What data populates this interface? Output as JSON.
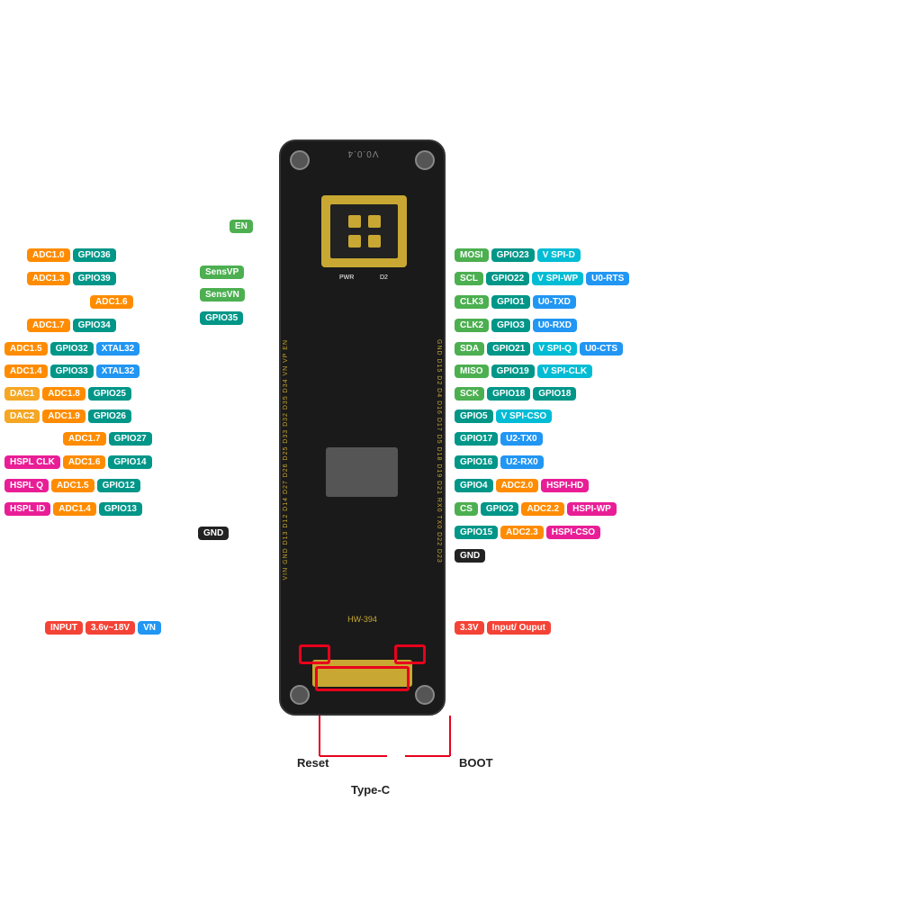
{
  "board": {
    "version": "V0.0.4",
    "hwLabel": "HW-394",
    "pwr": "PWR",
    "d2": "D2"
  },
  "labels": {
    "reset": "Reset",
    "typec": "Type-C",
    "boot": "BOOT"
  },
  "leftPins": [
    {
      "row": 0,
      "badges": [
        {
          "text": "EN",
          "color": "badge-green"
        }
      ]
    },
    {
      "row": 1,
      "badges": [
        {
          "text": "ADC1.0",
          "color": "badge-orange"
        },
        {
          "text": "GPIO36",
          "color": "badge-teal"
        }
      ]
    },
    {
      "row": 2,
      "badges": [
        {
          "text": "ADC1.3",
          "color": "badge-orange"
        },
        {
          "text": "GPIO39",
          "color": "badge-teal"
        }
      ]
    },
    {
      "row": 3,
      "badges": [
        {
          "text": "ADC1.6",
          "color": "badge-orange"
        }
      ]
    },
    {
      "row": 4,
      "badges": [
        {
          "text": "ADC1.7",
          "color": "badge-orange"
        },
        {
          "text": "GPIO34",
          "color": "badge-teal"
        }
      ]
    },
    {
      "row": 5,
      "badges": [
        {
          "text": "ADC1.5",
          "color": "badge-orange"
        },
        {
          "text": "GPIO32",
          "color": "badge-teal"
        },
        {
          "text": "XTAL32",
          "color": "badge-blue"
        }
      ]
    },
    {
      "row": 6,
      "badges": [
        {
          "text": "ADC1.4",
          "color": "badge-orange"
        },
        {
          "text": "GPIO33",
          "color": "badge-teal"
        },
        {
          "text": "XTAL32",
          "color": "badge-blue"
        }
      ]
    },
    {
      "row": 7,
      "badges": [
        {
          "text": "DAC1",
          "color": "badge-yellow"
        },
        {
          "text": "ADC1.8",
          "color": "badge-orange"
        },
        {
          "text": "GPIO25",
          "color": "badge-teal"
        }
      ]
    },
    {
      "row": 8,
      "badges": [
        {
          "text": "DAC2",
          "color": "badge-yellow"
        },
        {
          "text": "ADC1.9",
          "color": "badge-orange"
        },
        {
          "text": "GPIO26",
          "color": "badge-teal"
        }
      ]
    },
    {
      "row": 9,
      "badges": [
        {
          "text": "ADC1.7",
          "color": "badge-orange"
        },
        {
          "text": "GPIO27",
          "color": "badge-teal"
        }
      ]
    },
    {
      "row": 10,
      "badges": [
        {
          "text": "HSPL CLK",
          "color": "badge-pink"
        },
        {
          "text": "ADC1.6",
          "color": "badge-orange"
        },
        {
          "text": "GPIO14",
          "color": "badge-teal"
        }
      ]
    },
    {
      "row": 11,
      "badges": [
        {
          "text": "HSPL Q",
          "color": "badge-pink"
        },
        {
          "text": "ADC1.5",
          "color": "badge-orange"
        },
        {
          "text": "GPIO12",
          "color": "badge-teal"
        }
      ]
    },
    {
      "row": 12,
      "badges": [
        {
          "text": "HSPL ID",
          "color": "badge-pink"
        },
        {
          "text": "ADC1.4",
          "color": "badge-orange"
        },
        {
          "text": "GPIO13",
          "color": "badge-teal"
        }
      ]
    },
    {
      "row": 13,
      "badges": [
        {
          "text": "GND",
          "color": "badge-black"
        }
      ]
    },
    {
      "row": 14,
      "badges": [
        {
          "text": "INPUT",
          "color": "badge-red"
        },
        {
          "text": "3.6v~18V",
          "color": "badge-red"
        },
        {
          "text": "VN",
          "color": "badge-blue"
        }
      ]
    }
  ],
  "rightPins": [
    {
      "row": 0,
      "badges": [
        {
          "text": "MOSI",
          "color": "badge-green"
        },
        {
          "text": "GPIO23",
          "color": "badge-teal"
        },
        {
          "text": "V SPI-D",
          "color": "badge-cyan"
        }
      ]
    },
    {
      "row": 1,
      "badges": [
        {
          "text": "SCL",
          "color": "badge-green"
        },
        {
          "text": "GPIO22",
          "color": "badge-teal"
        },
        {
          "text": "V SPI-WP",
          "color": "badge-cyan"
        },
        {
          "text": "U0-RTS",
          "color": "badge-blue"
        }
      ]
    },
    {
      "row": 2,
      "badges": [
        {
          "text": "CLK3",
          "color": "badge-green"
        },
        {
          "text": "GPIO1",
          "color": "badge-teal"
        },
        {
          "text": "U0-TXD",
          "color": "badge-blue"
        }
      ]
    },
    {
      "row": 3,
      "badges": [
        {
          "text": "CLK2",
          "color": "badge-green"
        },
        {
          "text": "GPIO3",
          "color": "badge-teal"
        },
        {
          "text": "U0-RXD",
          "color": "badge-blue"
        }
      ]
    },
    {
      "row": 4,
      "badges": [
        {
          "text": "SDA",
          "color": "badge-green"
        },
        {
          "text": "GPIO21",
          "color": "badge-teal"
        },
        {
          "text": "V SPI-Q",
          "color": "badge-cyan"
        },
        {
          "text": "U0-CTS",
          "color": "badge-blue"
        }
      ]
    },
    {
      "row": 5,
      "badges": [
        {
          "text": "MISO",
          "color": "badge-green"
        },
        {
          "text": "GPIO19",
          "color": "badge-teal"
        },
        {
          "text": "V SPI-CLK",
          "color": "badge-cyan"
        }
      ]
    },
    {
      "row": 6,
      "badges": [
        {
          "text": "SCK",
          "color": "badge-green"
        },
        {
          "text": "GPIO18",
          "color": "badge-teal"
        },
        {
          "text": "GPIO18",
          "color": "badge-teal"
        }
      ]
    },
    {
      "row": 7,
      "badges": [
        {
          "text": "GPIO5",
          "color": "badge-teal"
        },
        {
          "text": "V SPI-CSO",
          "color": "badge-cyan"
        }
      ]
    },
    {
      "row": 8,
      "badges": [
        {
          "text": "GPIO17",
          "color": "badge-teal"
        },
        {
          "text": "U2-TX0",
          "color": "badge-blue"
        }
      ]
    },
    {
      "row": 9,
      "badges": [
        {
          "text": "GPIO16",
          "color": "badge-teal"
        },
        {
          "text": "U2-RX0",
          "color": "badge-blue"
        }
      ]
    },
    {
      "row": 10,
      "badges": [
        {
          "text": "GPIO4",
          "color": "badge-teal"
        },
        {
          "text": "ADC2.0",
          "color": "badge-orange"
        },
        {
          "text": "HSPI-HD",
          "color": "badge-pink"
        }
      ]
    },
    {
      "row": 11,
      "badges": [
        {
          "text": "CS",
          "color": "badge-green"
        },
        {
          "text": "GPIO2",
          "color": "badge-teal"
        },
        {
          "text": "ADC2.2",
          "color": "badge-orange"
        },
        {
          "text": "HSPI-WP",
          "color": "badge-pink"
        }
      ]
    },
    {
      "row": 12,
      "badges": [
        {
          "text": "GPIO15",
          "color": "badge-teal"
        },
        {
          "text": "ADC2.3",
          "color": "badge-orange"
        },
        {
          "text": "HSPI-CSO",
          "color": "badge-pink"
        }
      ]
    },
    {
      "row": 13,
      "badges": [
        {
          "text": "GND",
          "color": "badge-black"
        }
      ]
    },
    {
      "row": 14,
      "badges": [
        {
          "text": "3.3V",
          "color": "badge-red"
        },
        {
          "text": "Input/ Ouput",
          "color": "badge-red"
        }
      ]
    }
  ]
}
